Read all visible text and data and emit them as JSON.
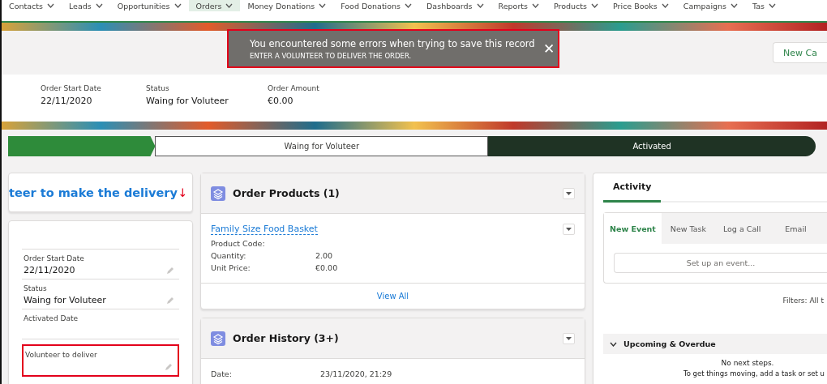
{
  "nav": [
    {
      "label": "Contacts",
      "selected": false
    },
    {
      "label": "Leads",
      "selected": false
    },
    {
      "label": "Opportunities",
      "selected": false
    },
    {
      "label": "Orders",
      "selected": true
    },
    {
      "label": "Money Donations",
      "selected": false
    },
    {
      "label": "Food Donations",
      "selected": false
    },
    {
      "label": "Dashboards",
      "selected": false
    },
    {
      "label": "Reports",
      "selected": false
    },
    {
      "label": "Products",
      "selected": false
    },
    {
      "label": "Price Books",
      "selected": false
    },
    {
      "label": "Campaigns",
      "selected": false
    },
    {
      "label": "Tas",
      "selected": false
    }
  ],
  "toast": {
    "title": "You encountered some errors when trying to save this record",
    "message": "ENTER A VOLUNTEER TO DELIVER THE ORDER.",
    "close": "✕"
  },
  "header": {
    "button": "New Ca"
  },
  "highlights": [
    {
      "label": "Order Start Date",
      "value": "22/11/2020"
    },
    {
      "label": "Status",
      "value": "Waing for Voluteer"
    },
    {
      "label": "Order Amount",
      "value": "€0.00"
    }
  ],
  "path": [
    {
      "completed": true,
      "selected": false
    },
    {
      "label": "Waing for Voluteer",
      "completed": false,
      "selected": false
    },
    {
      "label": "Activated",
      "completed": false,
      "selected": true
    }
  ],
  "notice": {
    "text": "teer to make the delivery",
    "mark": "↓"
  },
  "details": [
    {
      "label": "Order Start Date",
      "value": "22/11/2020",
      "error": false
    },
    {
      "label": "Status",
      "value": "Waing for Voluteer",
      "error": false
    },
    {
      "label": "Activated Date",
      "error": false
    },
    {
      "label": "Volunteer to deliver",
      "error": true
    }
  ],
  "order_products": {
    "title": "Order Products (1)",
    "product": "Family Size Food Basket",
    "fields": [
      {
        "label": "Product Code:"
      },
      {
        "label": "Quantity:",
        "value": "2.00"
      },
      {
        "label": "Unit Price:",
        "value": "€0.00"
      }
    ],
    "view_all": "View All"
  },
  "order_history": {
    "title": "Order History (3+)",
    "fields": [
      {
        "label": "Date:",
        "value": "23/11/2020, 21:29"
      }
    ]
  },
  "activity": {
    "title": "Activity",
    "tabs": [
      {
        "label": "New Event",
        "selected": true
      },
      {
        "label": "New Task",
        "selected": false
      },
      {
        "label": "Log a Call",
        "selected": false
      },
      {
        "label": "Email",
        "selected": false
      }
    ],
    "placeholder": "Set up an event...",
    "filters": "Filters: All t",
    "section": "Upcoming & Overdue",
    "empty": "No next steps.",
    "hint": "To get things moving, add a task or set u"
  }
}
